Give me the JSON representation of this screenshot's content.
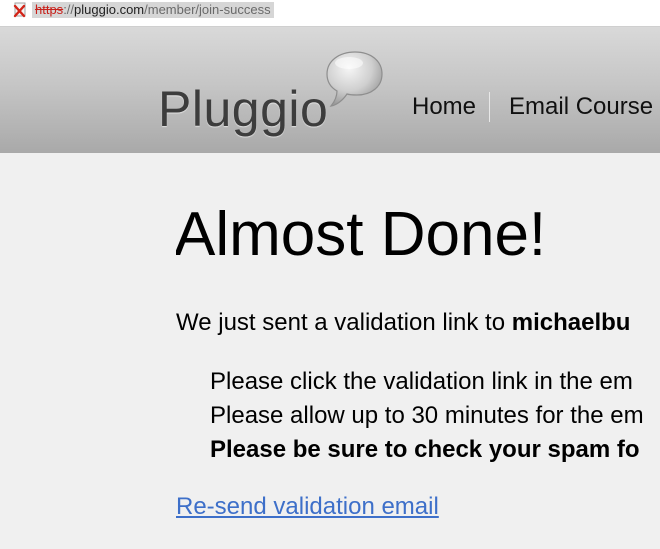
{
  "address_bar": {
    "url_scheme": "https",
    "url_separator": "://",
    "url_host": "pluggio.com",
    "url_path": "/member/join-success"
  },
  "header": {
    "logo_text": "Pluggio",
    "nav": [
      {
        "label": "Home"
      },
      {
        "label": "Email Course"
      }
    ]
  },
  "main": {
    "title": "Almost Done!",
    "lead_text": "We just sent a validation link to ",
    "email_partial": "michaelbu",
    "instructions": [
      "Please click the validation link in the em",
      "Please allow up to 30 minutes for the em",
      "Please be sure to check your spam fo"
    ],
    "resend_link": "Re-send validation email"
  },
  "colors": {
    "link": "#3d6fc9",
    "insecure_scheme": "#c8211b",
    "background": "#f0f0f0"
  }
}
